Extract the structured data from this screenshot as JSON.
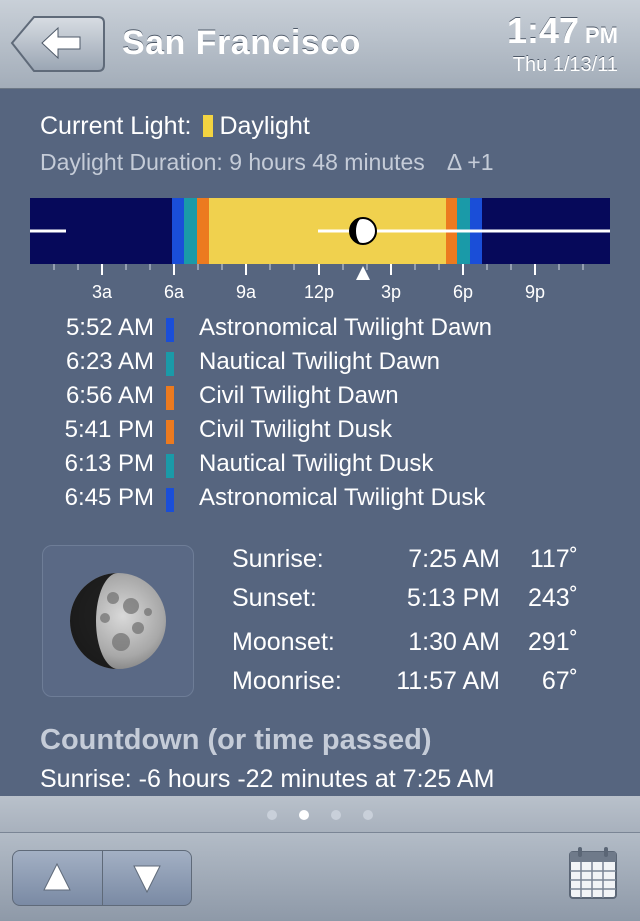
{
  "header": {
    "city": "San Francisco",
    "time": "1:47",
    "ampm": "PM",
    "date": "Thu 1/13/11"
  },
  "current": {
    "label": "Current Light:",
    "value": "Daylight",
    "duration": "Daylight Duration: 9 hours 48 minutes",
    "delta": "Δ  +1"
  },
  "timeline": {
    "tick_labels": [
      "3a",
      "6a",
      "9a",
      "12p",
      "3p",
      "6p",
      "9p"
    ],
    "colors": {
      "night": "#06095a",
      "astronomical": "#1a4ed8",
      "nautical": "#1a9aa8",
      "civil": "#ec7a1f",
      "day": "#f0d14e"
    }
  },
  "events": [
    {
      "time": "5:52 AM",
      "name": "Astronomical Twilight Dawn",
      "color": "#1a4ed8"
    },
    {
      "time": "6:23 AM",
      "name": "Nautical Twilight Dawn",
      "color": "#1a9aa8"
    },
    {
      "time": "6:56 AM",
      "name": "Civil Twilight Dawn",
      "color": "#ec7a1f"
    },
    {
      "time": "5:41 PM",
      "name": "Civil Twilight Dusk",
      "color": "#ec7a1f"
    },
    {
      "time": "6:13 PM",
      "name": "Nautical Twilight Dusk",
      "color": "#1a9aa8"
    },
    {
      "time": "6:45 PM",
      "name": "Astronomical Twilight Dusk",
      "color": "#1a4ed8"
    }
  ],
  "sun_moon": [
    {
      "label": "Sunrise:",
      "time": "7:25 AM",
      "deg": "117˚"
    },
    {
      "label": "Sunset:",
      "time": "5:13 PM",
      "deg": "243˚"
    },
    {
      "label": "Moonset:",
      "time": "1:30 AM",
      "deg": "291˚"
    },
    {
      "label": "Moonrise:",
      "time": "11:57 AM",
      "deg": "67˚"
    }
  ],
  "countdown": {
    "title": "Countdown (or time passed)",
    "text": "Sunrise: -6 hours -22 minutes at 7:25 AM"
  },
  "pager": {
    "pages": 4,
    "active_index": 1
  },
  "toolbar": {
    "up_icon": "up-triangle-icon",
    "down_icon": "down-triangle-icon",
    "calendar_icon": "calendar-icon"
  }
}
